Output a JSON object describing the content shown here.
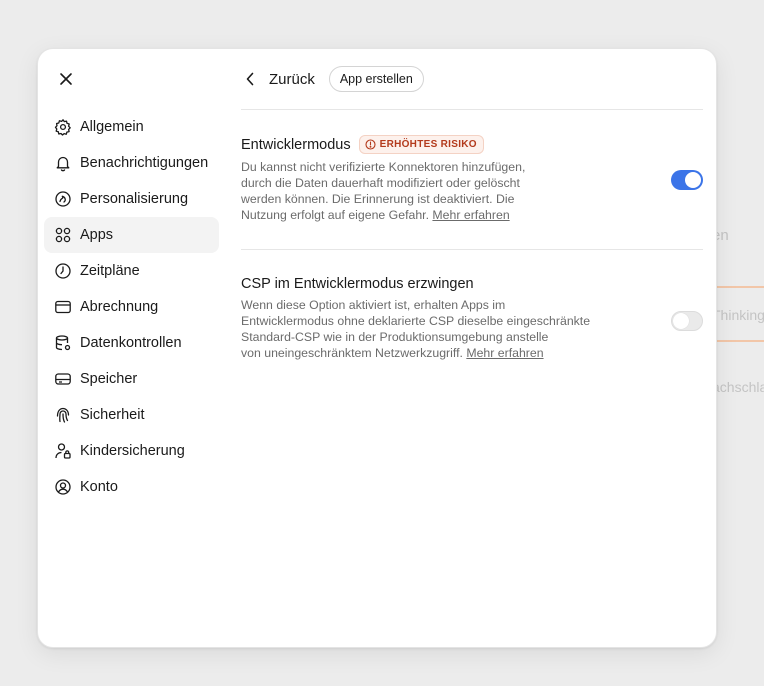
{
  "background": {
    "fragment_1": "en",
    "fragment_2": "Thinking",
    "fragment_3": "achschla"
  },
  "modal": {
    "close_icon": "close-icon",
    "nav": [
      {
        "label": "Allgemein",
        "icon": "gear-icon"
      },
      {
        "label": "Benachrichtigungen",
        "icon": "bell-icon"
      },
      {
        "label": "Personalisierung",
        "icon": "personalization-icon"
      },
      {
        "label": "Apps",
        "icon": "apps-grid-icon",
        "active": true
      },
      {
        "label": "Zeitpläne",
        "icon": "clock-icon"
      },
      {
        "label": "Abrechnung",
        "icon": "credit-card-icon"
      },
      {
        "label": "Datenkontrollen",
        "icon": "database-icon"
      },
      {
        "label": "Speicher",
        "icon": "storage-icon"
      },
      {
        "label": "Sicherheit",
        "icon": "fingerprint-icon"
      },
      {
        "label": "Kindersicherung",
        "icon": "parental-control-icon"
      },
      {
        "label": "Konto",
        "icon": "account-icon"
      }
    ],
    "header": {
      "back_label": "Zurück",
      "create_app_label": "App erstellen"
    },
    "settings": {
      "developer_mode": {
        "title": "Entwicklermodus",
        "badge": "ERHÖHTES RISIKO",
        "description": "Du kannst nicht verifizierte Konnektoren hinzufügen,\ndurch die Daten dauerhaft modifiziert oder gelöscht\nwerden können. Die Erinnerung ist deaktiviert. Die\nNutzung erfolgt auf eigene Gefahr. ",
        "link": "Mehr erfahren",
        "enabled": true
      },
      "csp_enforce": {
        "title": "CSP im Entwicklermodus erzwingen",
        "description": "Wenn diese Option aktiviert ist, erhalten Apps im\nEntwicklermodus ohne deklarierte CSP dieselbe eingeschränkte\nStandard-CSP wie in der Produktionsumgebung anstelle\nvon uneingeschränktem Netzwerkzugriff. ",
        "link": "Mehr erfahren",
        "enabled": false
      }
    },
    "colors": {
      "accent": "#3b74e8",
      "risk_text": "#b33a1c",
      "risk_bg": "#fdf1ec"
    }
  }
}
